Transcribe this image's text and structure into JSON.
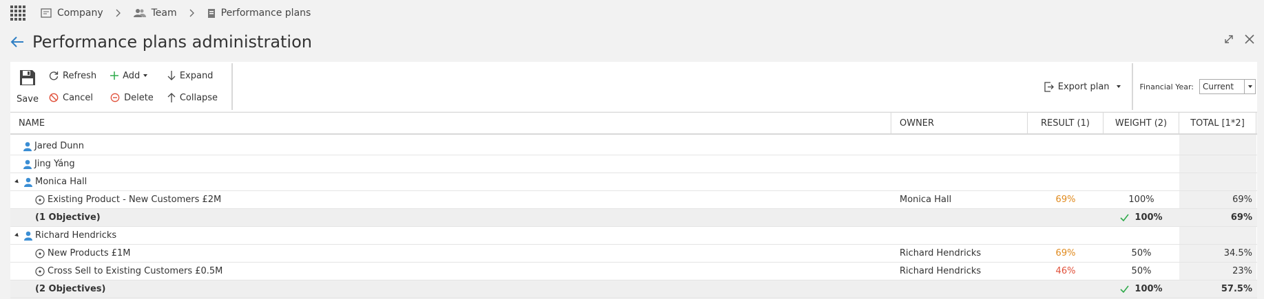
{
  "breadcrumb": {
    "items": [
      {
        "label": "Company",
        "icon": "company-icon"
      },
      {
        "label": "Team",
        "icon": "team-icon"
      },
      {
        "label": "Performance plans",
        "icon": "plans-icon"
      }
    ]
  },
  "page": {
    "title": "Performance plans administration"
  },
  "toolbar": {
    "save": "Save",
    "refresh": "Refresh",
    "cancel": "Cancel",
    "add": "Add",
    "delete": "Delete",
    "expand": "Expand",
    "collapse": "Collapse",
    "export": "Export plan",
    "financial_year_label": "Financial Year:",
    "financial_year_value": "Current"
  },
  "table": {
    "columns": {
      "name": "NAME",
      "owner": "OWNER",
      "result": "RESULT (1)",
      "weight": "WEIGHT (2)",
      "total": "TOTAL [1*2]"
    },
    "rows": [
      {
        "type": "person",
        "name": "Jared Dunn",
        "expandable": false
      },
      {
        "type": "person",
        "name": "Jing Yáng",
        "expandable": false
      },
      {
        "type": "person",
        "name": "Monica Hall",
        "expandable": true
      },
      {
        "type": "objective",
        "name": "Existing Product - New Customers £2M",
        "owner": "Monica Hall",
        "result": "69%",
        "result_color": "orange",
        "weight": "100%",
        "total": "69%"
      },
      {
        "type": "summary",
        "name": "(1 Objective)",
        "weight": "100%",
        "total": "69%"
      },
      {
        "type": "person",
        "name": "Richard Hendricks",
        "expandable": true
      },
      {
        "type": "objective",
        "name": "New Products £1M",
        "owner": "Richard Hendricks",
        "result": "69%",
        "result_color": "orange",
        "weight": "50%",
        "total": "34.5%"
      },
      {
        "type": "objective",
        "name": "Cross Sell to Existing Customers £0.5M",
        "owner": "Richard Hendricks",
        "result": "46%",
        "result_color": "red",
        "weight": "50%",
        "total": "23%"
      },
      {
        "type": "summary",
        "name": "(2 Objectives)",
        "weight": "100%",
        "total": "57.5%"
      }
    ]
  },
  "colors": {
    "accent": "#2f7fc4",
    "orange": "#e08a1e",
    "red": "#e0503a",
    "check": "#2eaa4a"
  }
}
